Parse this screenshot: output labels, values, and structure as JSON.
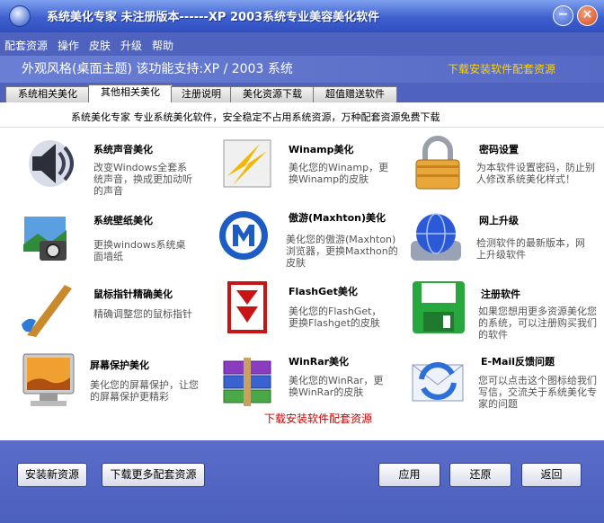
{
  "window": {
    "title": "系统美化专家  未注册版本------XP  2003系统专业美容美化软件",
    "minimize": "−",
    "close": "×"
  },
  "menu": [
    "配套资源",
    "操作",
    "皮肤",
    "升级",
    "帮助"
  ],
  "theme_bar": {
    "label": "外观风格(桌面主题)   该功能支持:XP / 2003 系统",
    "download_link": "下载安装软件配套资源"
  },
  "tabs": [
    "系统相关美化",
    "其他相关美化",
    "注册说明",
    "美化资源下载",
    "超值赠送软件"
  ],
  "active_tab": 1,
  "description": "系统美化专家  专业系统美化软件，安全稳定不占用系统资源，万种配套资源免费下载",
  "items": [
    {
      "name": "系统声音美化",
      "text": "改变Windows全套系统声音，换成更加动听的声音",
      "icon": "speaker-icon"
    },
    {
      "name": "Winamp美化",
      "text": "美化您的Winamp，更换Winamp的皮肤",
      "icon": "winamp-icon"
    },
    {
      "name": "密码设置",
      "text": "为本软件设置密码，防止别人修改系统美化样式！",
      "icon": "lock-icon"
    },
    {
      "name": "系统壁纸美化",
      "text": "更换windows系统桌面墙纸",
      "icon": "wallpaper-icon"
    },
    {
      "name": "傲游(Maxhton)美化",
      "text": "美化您的傲游(Maxhton)浏览器，更换Maxthon的皮肤",
      "icon": "maxthon-icon"
    },
    {
      "name": "网上升级",
      "text": "检测软件的最新版本，网上升级软件",
      "icon": "globe-icon"
    },
    {
      "name": "鼠标指针精确美化",
      "text": "精确调整您的鼠标指针",
      "icon": "brush-icon"
    },
    {
      "name": "FlashGet美化",
      "text": "美化您的FlashGet，更换Flashget的皮肤",
      "icon": "flashget-icon"
    },
    {
      "name": "注册软件",
      "text": "如果您想用更多资源美化您的系统，可以注册购买我们的软件",
      "icon": "floppy-icon"
    },
    {
      "name": "屏幕保护美化",
      "text": "美化您的屏幕保护，让您的屏幕保护更精彩",
      "icon": "monitor-icon"
    },
    {
      "name": "WinRar美化",
      "text": "美化您的WinRar，更换WinRar的皮肤",
      "icon": "winrar-icon"
    },
    {
      "name": "E-Mail反馈问题",
      "text": "您可以点击这个图标给我们写信，交流关于系统美化专家的问题",
      "icon": "email-icon"
    }
  ],
  "bottom_link": "下载安装软件配套资源",
  "buttons": {
    "install": "安装新资源",
    "download_more": "下载更多配套资源",
    "apply": "应用",
    "restore": "还原",
    "back": "返回"
  },
  "colors": {
    "titlebar": "#3f5fcf",
    "body": "#4f63be",
    "link_yellow": "#ffd400",
    "link_red": "#cc0000"
  }
}
